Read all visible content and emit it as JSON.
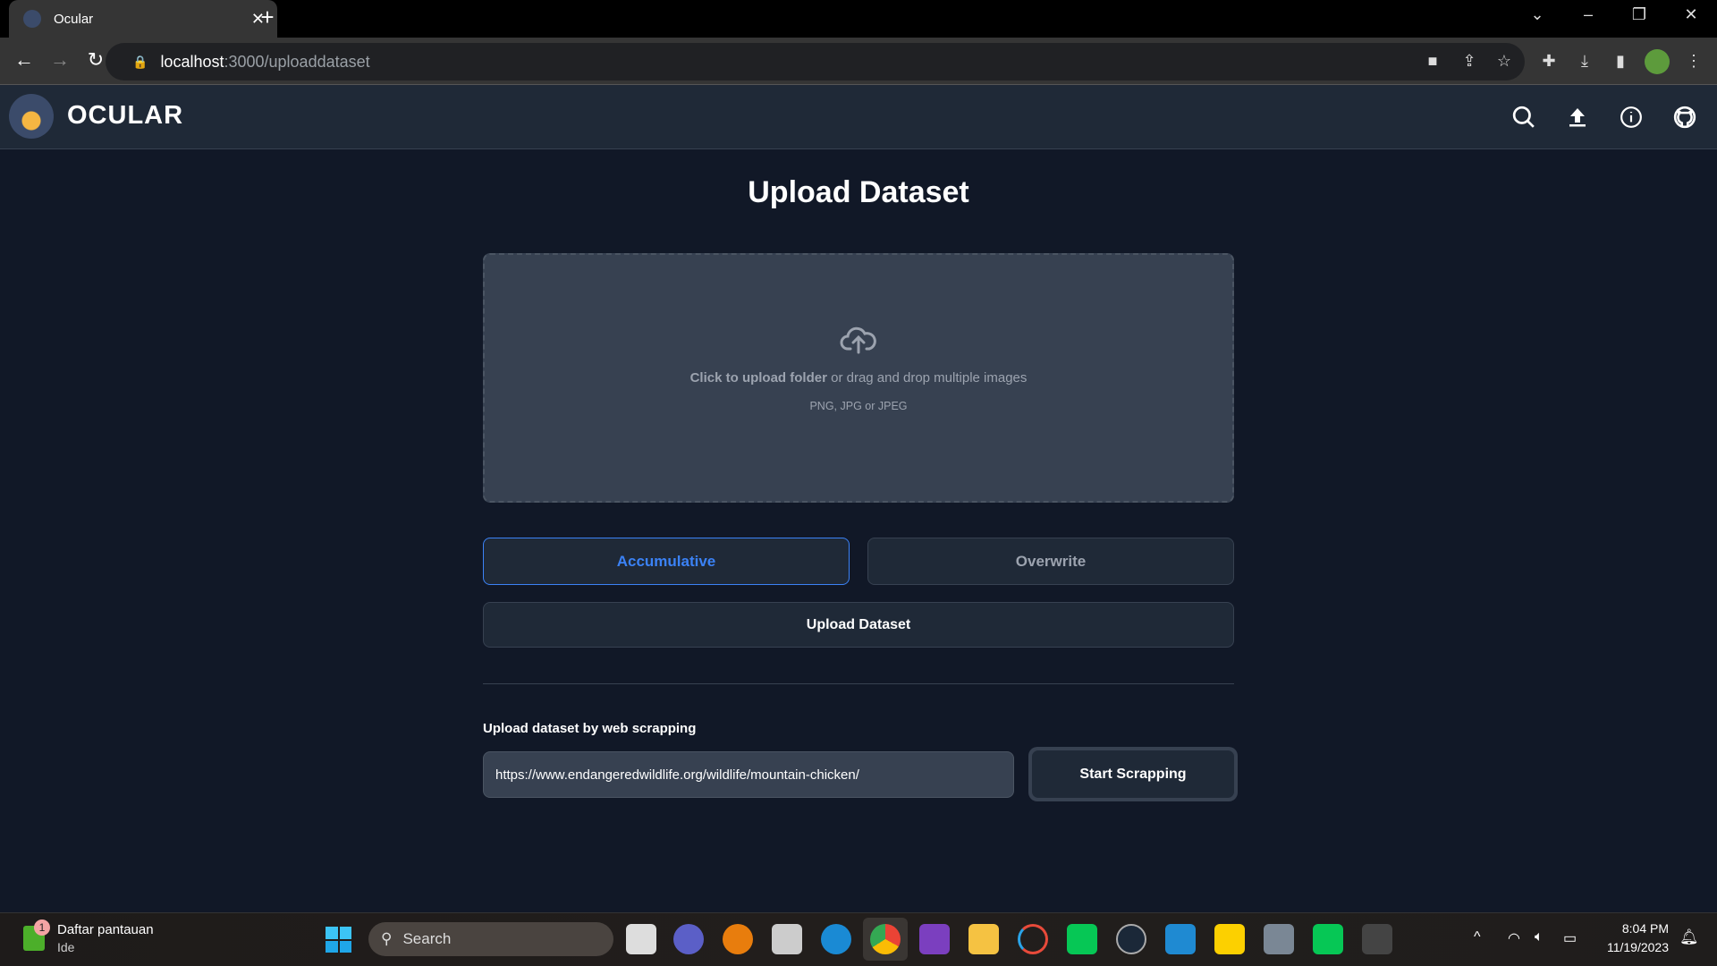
{
  "browser": {
    "tab_title": "Ocular",
    "url_host": "localhost",
    "url_path": ":3000/uploaddataset"
  },
  "app": {
    "brand": "OCULAR",
    "nav_icons": [
      "search-icon",
      "upload-icon",
      "info-icon",
      "github-icon"
    ]
  },
  "page": {
    "title": "Upload Dataset",
    "dropzone": {
      "bold": "Click to upload folder",
      "rest": " or drag and drop multiple images",
      "formats": "PNG, JPG or JPEG"
    },
    "modes": [
      {
        "label": "Accumulative",
        "selected": true
      },
      {
        "label": "Overwrite",
        "selected": false
      }
    ],
    "upload_button": "Upload Dataset",
    "scrape": {
      "label": "Upload dataset by web scrapping",
      "url_value": "https://www.endangeredwildlife.org/wildlife/mountain-chicken/",
      "button": "Start Scrapping"
    }
  },
  "colors": {
    "accent": "#3b82f6",
    "background": "#111827",
    "navbar": "#1f2937",
    "dropzone": "#374151"
  },
  "taskbar": {
    "widget_title": "Daftar pantauan",
    "widget_sub": "Ide",
    "widget_badge": "1",
    "search": "Search",
    "time": "8:04 PM",
    "date": "11/19/2023"
  }
}
